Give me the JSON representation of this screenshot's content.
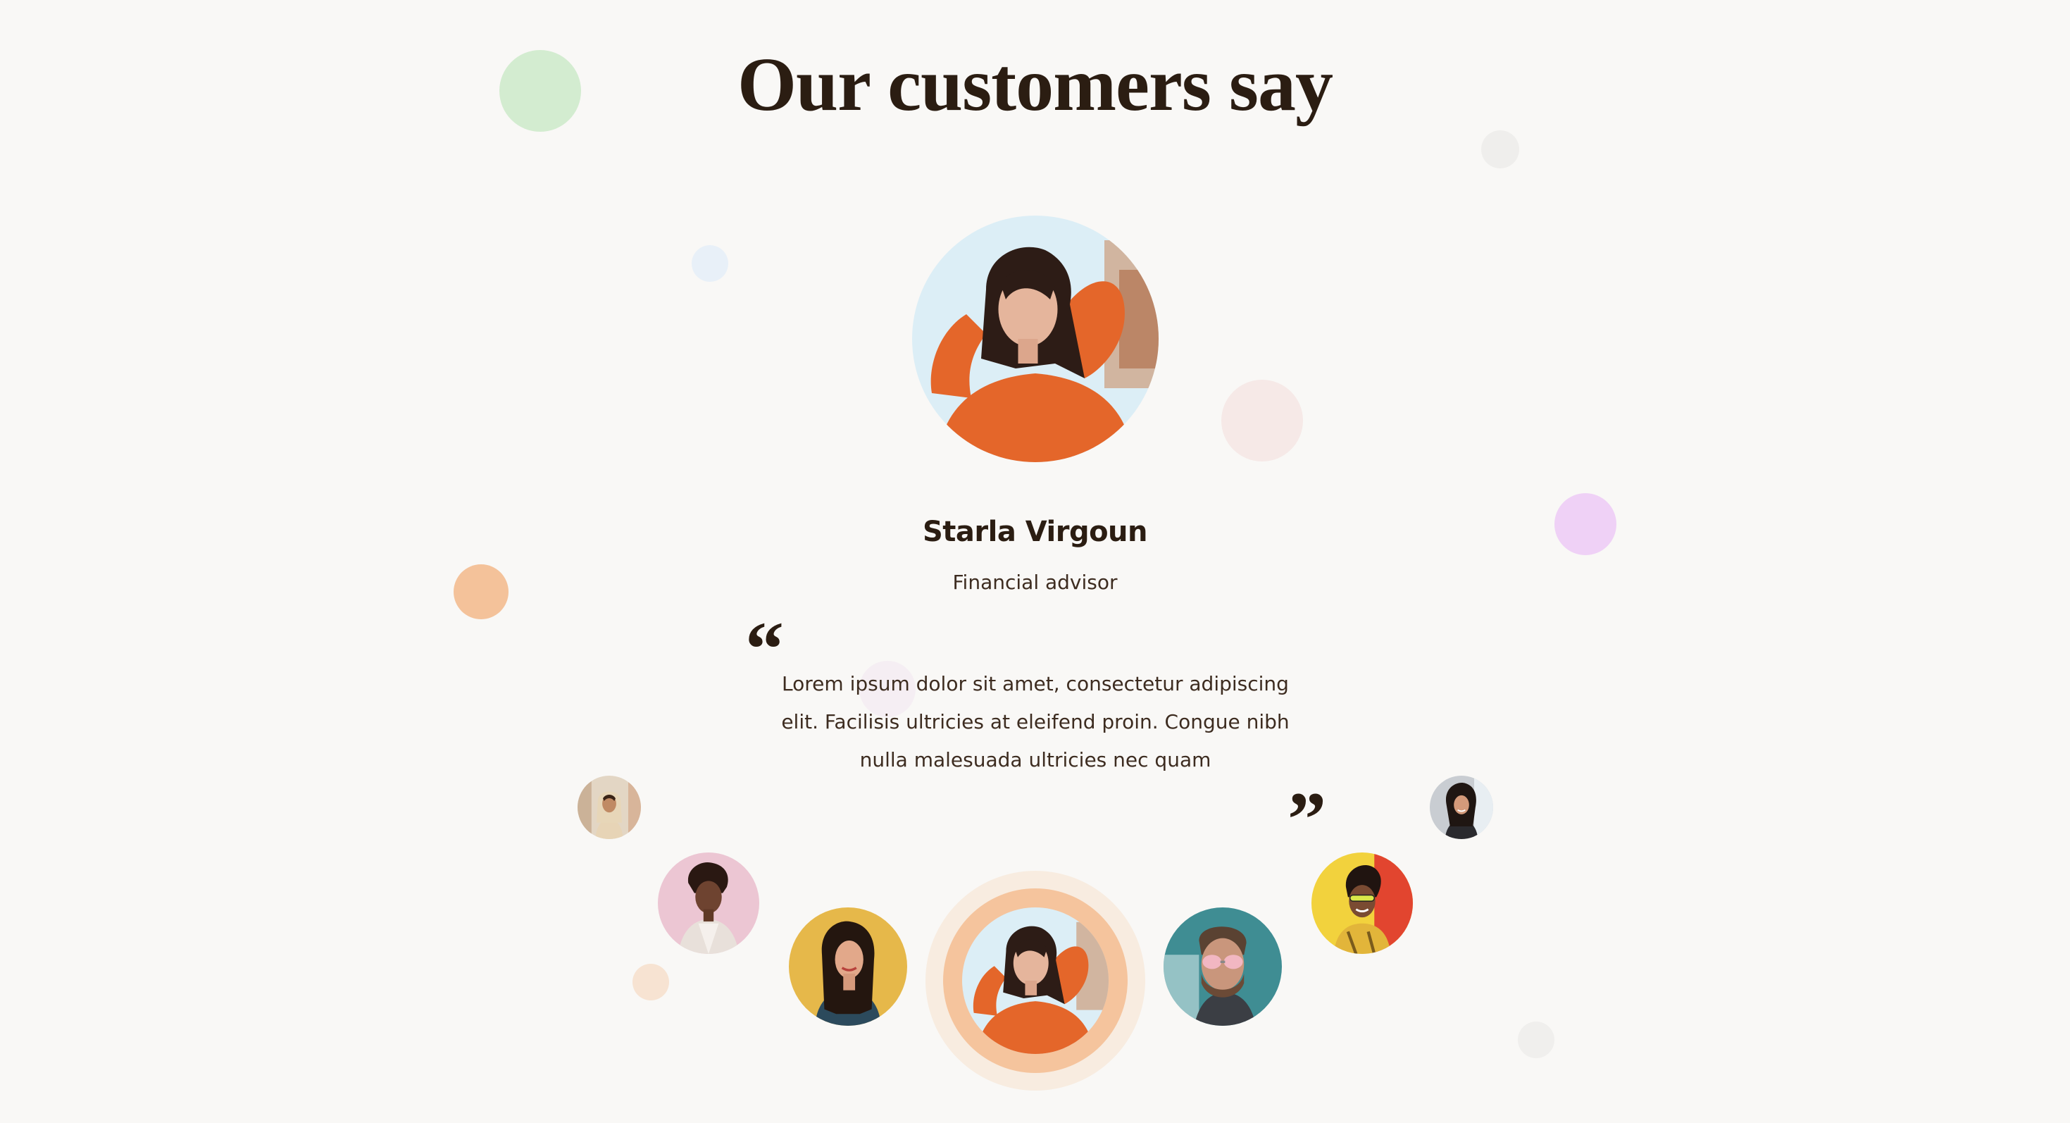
{
  "section": {
    "title": "Our customers say"
  },
  "active_testimonial": {
    "name": "Starla Virgoun",
    "role": "Financial advisor",
    "quote_open": "“",
    "quote_close": "”",
    "quote_lines": [
      "Lorem ipsum dolor sit amet, consectetur adipiscing",
      "elit. Facilisis ultricies at eleifend proin. Congue nibh",
      "nulla malesuada ultricies nec quam"
    ]
  },
  "colors": {
    "background": "#f9f8f6",
    "text_dark": "#2b1d12",
    "active_ring_outer": "#f8ece0",
    "active_ring_inner": "#f5c49d"
  },
  "customer_thumbnails": [
    {
      "id": "customer-1",
      "photo_background": "#e3d6c4",
      "active": false
    },
    {
      "id": "customer-2",
      "photo_background": "#ecc6d3",
      "active": false
    },
    {
      "id": "customer-3",
      "photo_background": "#e6b84a",
      "active": false
    },
    {
      "id": "customer-4",
      "photo_background": "#dceef6",
      "active": true
    },
    {
      "id": "customer-5",
      "photo_background": "#3f8d93",
      "active": false
    },
    {
      "id": "customer-6",
      "photo_background": "#f2d23d",
      "active": false
    },
    {
      "id": "customer-7",
      "photo_background": "#c9cdd2",
      "active": false
    }
  ]
}
